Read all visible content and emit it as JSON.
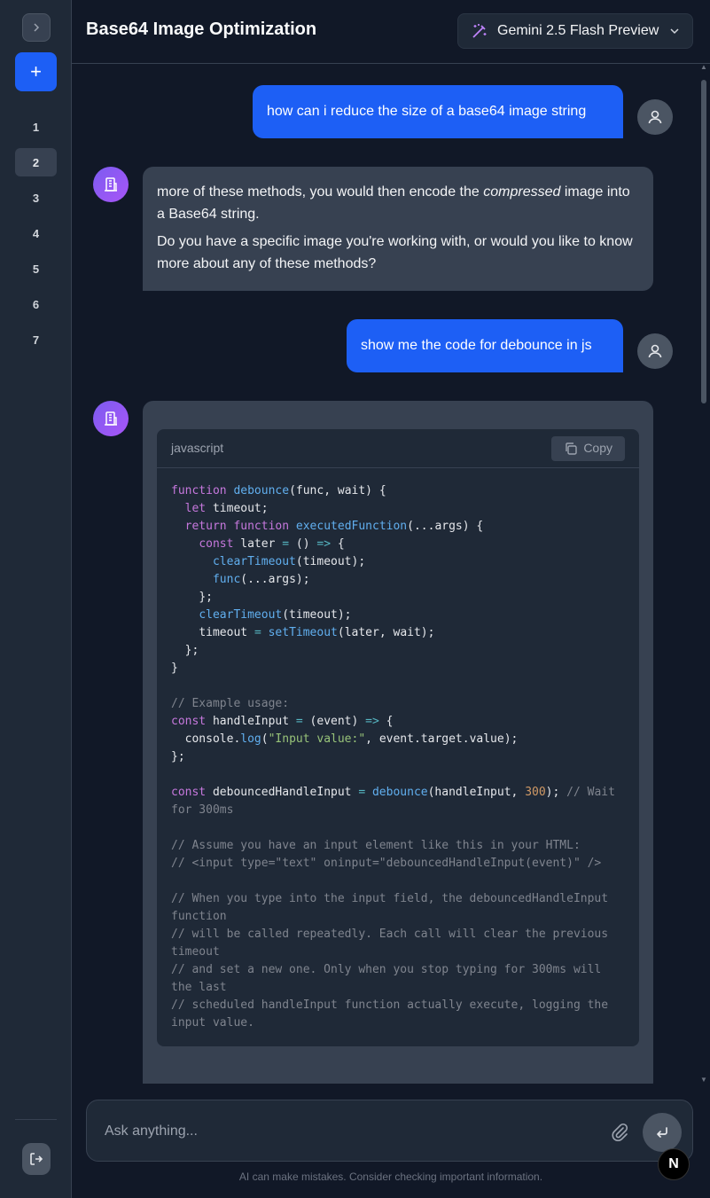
{
  "sidebar": {
    "toggle_icon": "chevron-right-icon",
    "new_chat_label": "+",
    "items": [
      "1",
      "2",
      "3",
      "4",
      "5",
      "6",
      "7"
    ],
    "active_index": 1,
    "logout_icon": "logout-icon"
  },
  "header": {
    "title": "Base64 Image Optimization",
    "model": "Gemini 2.5 Flash Preview"
  },
  "messages": {
    "user1": "how can i reduce the size of a base64 image string",
    "ai1_p1_a": " more of these methods, you would then encode the ",
    "ai1_p1_em": "compressed",
    "ai1_p1_b": " image into a Base64 string.",
    "ai1_p2": "Do you have a specific image you're working with, or would you like to know more about any of these methods?",
    "user2": "show me the code for debounce in js",
    "code_lang": "javascript",
    "copy_label": "Copy"
  },
  "input": {
    "placeholder": "Ask anything...",
    "disclaimer": "AI can make mistakes. Consider checking important information."
  },
  "colors": {
    "accent": "#1d5ff5",
    "background": "#111827",
    "panel": "#1f2937",
    "bubble": "#374151"
  }
}
